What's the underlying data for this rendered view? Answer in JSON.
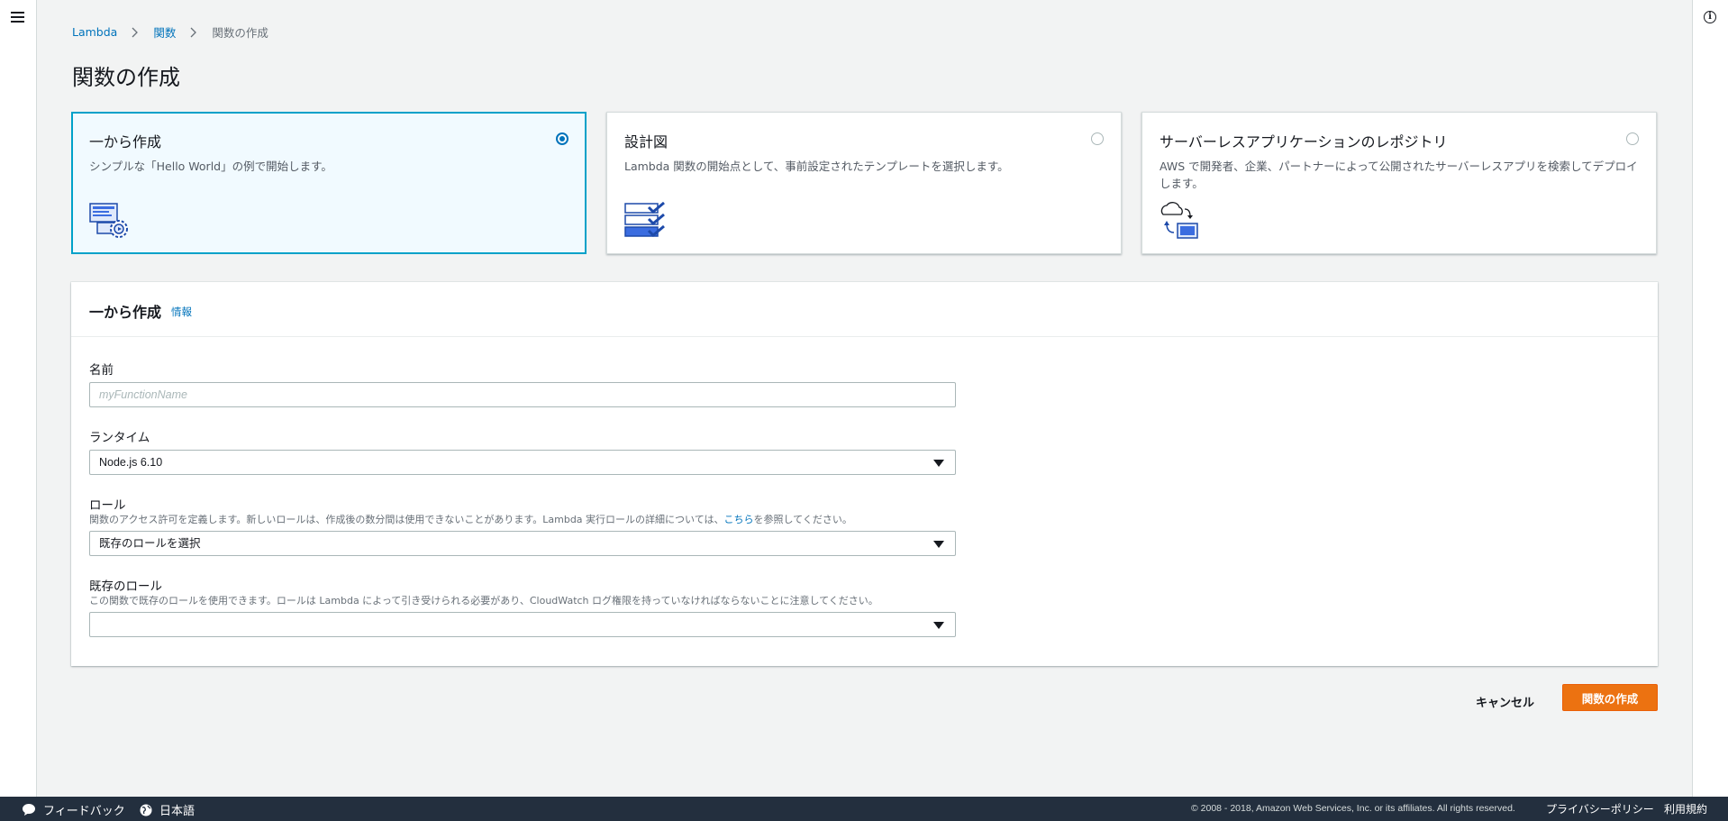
{
  "breadcrumb": {
    "items": [
      "Lambda",
      "関数"
    ],
    "current": "関数の作成"
  },
  "page_title": "関数の作成",
  "options": [
    {
      "title": "一から作成",
      "desc": "シンプルな「Hello World」の例で開始します。",
      "selected": true,
      "icon": "code-gear-icon"
    },
    {
      "title": "設計図",
      "desc": "Lambda 関数の開始点として、事前設定されたテンプレートを選択します。",
      "selected": false,
      "icon": "checklist-icon"
    },
    {
      "title": "サーバーレスアプリケーションのレポジトリ",
      "desc": "AWS で開発者、企業、パートナーによって公開されたサーバーレスアプリを検索してデプロイします。",
      "selected": false,
      "icon": "cloud-deploy-icon"
    }
  ],
  "form": {
    "title": "一から作成",
    "info_link": "情報",
    "name": {
      "label": "名前",
      "placeholder": "myFunctionName",
      "value": ""
    },
    "runtime": {
      "label": "ランタイム",
      "value": "Node.js 6.10"
    },
    "role": {
      "label": "ロール",
      "desc_before": "関数のアクセス許可を定義します。新しいロールは、作成後の数分間は使用できないことがあります。Lambda 実行ロールの詳細については、",
      "desc_link": "こちら",
      "desc_after": "を参照してください。",
      "value": "既存のロールを選択"
    },
    "existing_role": {
      "label": "既存のロール",
      "desc": "この関数で既存のロールを使用できます。ロールは Lambda によって引き受けられる必要があり、CloudWatch ログ権限を持っていなければならないことに注意してください。",
      "value": ""
    }
  },
  "buttons": {
    "cancel": "キャンセル",
    "create": "関数の作成"
  },
  "footer": {
    "feedback": "フィードバック",
    "language": "日本語",
    "copyright": "© 2008 - 2018, Amazon Web Services, Inc. or its affiliates. All rights reserved.",
    "privacy": "プライバシーポリシー",
    "terms": "利用規約"
  },
  "colors": {
    "accent": "#0073bb",
    "primary_button": "#ec7211",
    "footer_bg": "#232f3e",
    "selected_card_bg": "#f1faff"
  }
}
